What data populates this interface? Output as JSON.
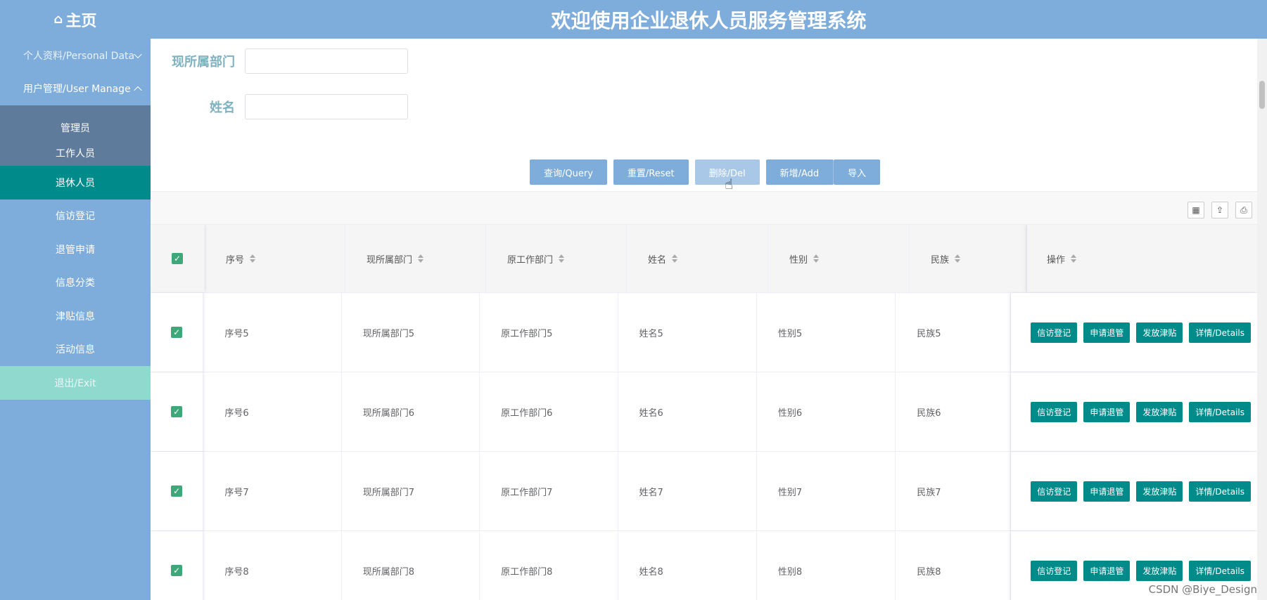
{
  "header": {
    "home_label": "主页",
    "title": "欢迎使用企业退休人员服务管理系统"
  },
  "sidebar": {
    "personal": "个人资料/Personal Data",
    "user_manage": "用户管理/User Manage",
    "sub": [
      "管理员",
      "工作人员",
      "退休人员"
    ],
    "items": [
      "信访登记",
      "退管申请",
      "信息分类",
      "津贴信息",
      "活动信息"
    ],
    "exit": "退出/Exit"
  },
  "search": {
    "dept_label": "现所属部门",
    "dept_value": "",
    "name_label": "姓名",
    "name_value": ""
  },
  "actions": [
    "查询/Query",
    "重置/Reset",
    "删除/Del",
    "新增/Add",
    "导入"
  ],
  "table": {
    "headers": [
      "序号",
      "现所属部门",
      "原工作部门",
      "姓名",
      "性别",
      "民族",
      "操作"
    ],
    "rows": [
      [
        "序号5",
        "现所属部门5",
        "原工作部门5",
        "姓名5",
        "性别5",
        "民族5"
      ],
      [
        "序号6",
        "现所属部门6",
        "原工作部门6",
        "姓名6",
        "性别6",
        "民族6"
      ],
      [
        "序号7",
        "现所属部门7",
        "原工作部门7",
        "姓名7",
        "性别7",
        "民族7"
      ],
      [
        "序号8",
        "现所属部门8",
        "原工作部门8",
        "姓名8",
        "性别8",
        "民族8"
      ]
    ],
    "row_actions": [
      "信访登记",
      "申请退管",
      "发放津贴",
      "详情/Details"
    ]
  },
  "watermark": "CSDN @Biye_Design",
  "colors": {
    "primary": "#7eaddb",
    "active": "#008b8b",
    "exit": "#8fd9cf",
    "check": "#3fa87a"
  }
}
